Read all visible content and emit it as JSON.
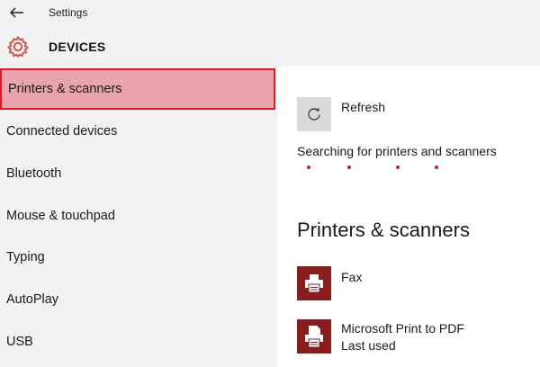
{
  "window": {
    "title": "Settings"
  },
  "header": {
    "title": "DEVICES"
  },
  "sidebar": {
    "items": [
      {
        "label": "Printers & scanners",
        "selected": true
      },
      {
        "label": "Connected devices"
      },
      {
        "label": "Bluetooth"
      },
      {
        "label": "Mouse & touchpad"
      },
      {
        "label": "Typing"
      },
      {
        "label": "AutoPlay"
      },
      {
        "label": "USB"
      }
    ]
  },
  "main": {
    "refresh_label": "Refresh",
    "searching_text": "Searching for printers and scanners",
    "section_title": "Printers & scanners",
    "devices": [
      {
        "name": "Fax",
        "status": ""
      },
      {
        "name": "Microsoft Print to PDF",
        "status": "Last used"
      }
    ]
  },
  "colors": {
    "accent": "#e8161d",
    "selected_bg": "#e8a4aa",
    "device_tile": "#8a1c1c",
    "progress_dot": "#c2185b",
    "gear": "#d9534f"
  },
  "icons": [
    "back-arrow-icon",
    "gear-icon",
    "refresh-icon",
    "fax-icon",
    "pdf-printer-icon"
  ]
}
